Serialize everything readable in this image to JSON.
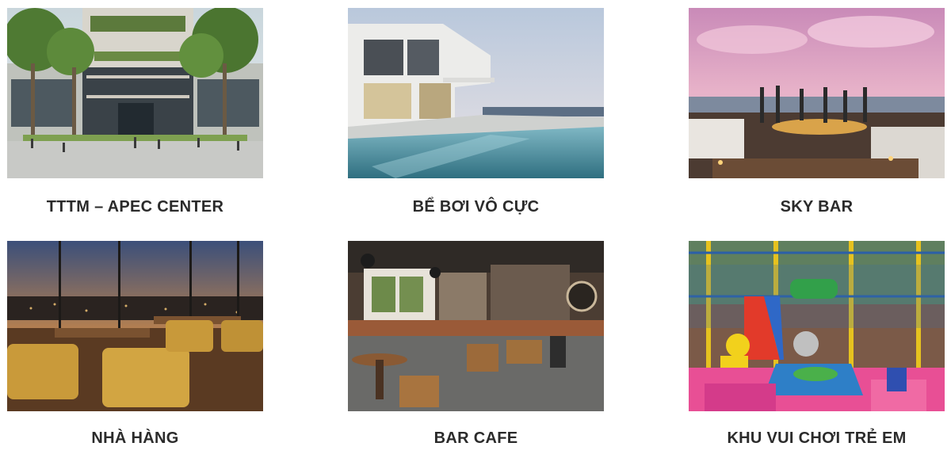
{
  "amenities": [
    {
      "title": "TTTM – APEC CENTER",
      "image": "apec-center-photo"
    },
    {
      "title": "BỂ BƠI VÔ CỰC",
      "image": "infinity-pool-photo"
    },
    {
      "title": "SKY BAR",
      "image": "sky-bar-photo"
    },
    {
      "title": "NHÀ HÀNG",
      "image": "restaurant-photo"
    },
    {
      "title": "BAR CAFE",
      "image": "bar-cafe-photo"
    },
    {
      "title": "KHU VUI CHƠI TRẺ EM",
      "image": "kids-playground-photo"
    }
  ]
}
